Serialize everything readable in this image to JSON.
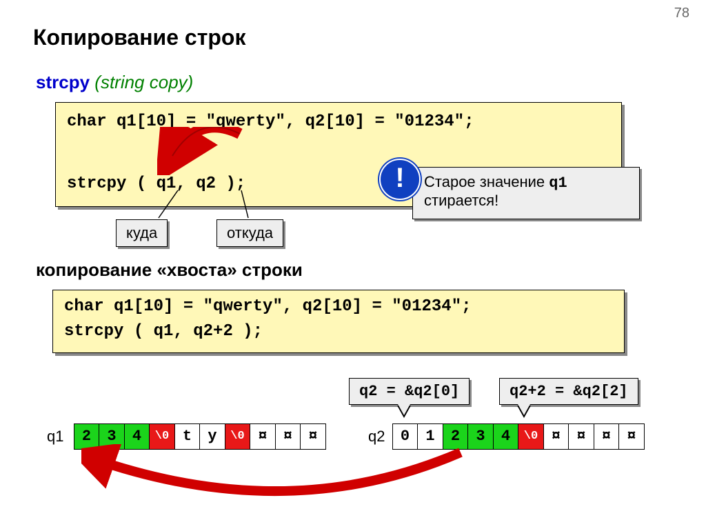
{
  "page_number": "78",
  "title": "Копирование строк",
  "subtitle": {
    "fn": "strcpy",
    "desc": "(string copy)"
  },
  "code1": {
    "line1": "char q1[10] = \"qwerty\", q2[10] = \"01234\";",
    "line2": "strcpy ( q1, q2 );"
  },
  "labels": {
    "kuda": "куда",
    "otkuda": "откуда"
  },
  "note": {
    "text1": "Старое значение ",
    "q1": "q1",
    "text2": "стирается!"
  },
  "excl": "!",
  "mid_text": "копирование «хвоста» строки",
  "code2": {
    "line1": "char q1[10] = \"qwerty\", q2[10] = \"01234\";",
    "line2": "strcpy ( q1, q2+2 );"
  },
  "bubbles": {
    "b1": "q2 = &q2[0]",
    "b2": "q2+2 = &q2[2]"
  },
  "strip_labels": {
    "s1": "q1",
    "s2": "q2"
  },
  "strip1_cells": [
    "2",
    "3",
    "4",
    "\\0",
    "t",
    "y",
    "\\0",
    "¤",
    "¤",
    "¤"
  ],
  "strip1_styles": [
    "green",
    "green",
    "green",
    "red",
    "",
    "",
    "red",
    "",
    "",
    ""
  ],
  "strip2_cells": [
    "0",
    "1",
    "2",
    "3",
    "4",
    "\\0",
    "¤",
    "¤",
    "¤",
    "¤"
  ],
  "strip2_styles": [
    "",
    "",
    "green",
    "green",
    "green",
    "red",
    "",
    "",
    "",
    ""
  ]
}
